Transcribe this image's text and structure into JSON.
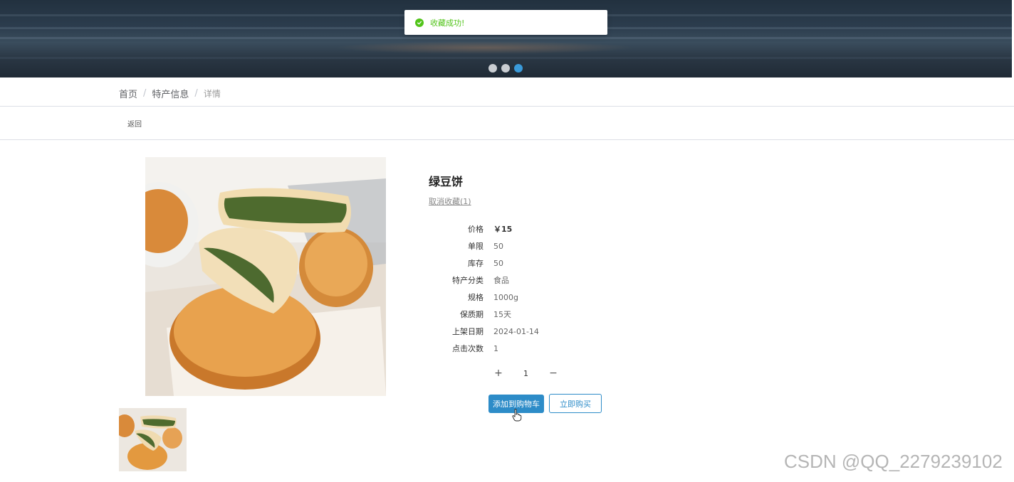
{
  "toast": {
    "message": "收藏成功!"
  },
  "banner": {
    "dots": 3,
    "active_dot": 3
  },
  "breadcrumb": {
    "home": "首页",
    "category": "特产信息",
    "current": "详情",
    "separator": "/"
  },
  "back_label": "返回",
  "product": {
    "name": "绿豆饼",
    "favorite_label": "取消收藏(1)",
    "specs": [
      {
        "label": "价格",
        "value": "￥15"
      },
      {
        "label": "单限",
        "value": "50"
      },
      {
        "label": "库存",
        "value": "50"
      },
      {
        "label": "特产分类",
        "value": "食品"
      },
      {
        "label": "规格",
        "value": "1000g"
      },
      {
        "label": "保质期",
        "value": "15天"
      },
      {
        "label": "上架日期",
        "value": "2024-01-14"
      },
      {
        "label": "点击次数",
        "value": "1"
      }
    ],
    "quantity": "1",
    "plus": "+",
    "minus": "−"
  },
  "actions": {
    "add_to_cart": "添加到购物车",
    "buy_now": "立即购买"
  },
  "watermark": "CSDN @QQ_2279239102",
  "colors": {
    "primary": "#2d8cc8",
    "success": "#52c41a"
  }
}
